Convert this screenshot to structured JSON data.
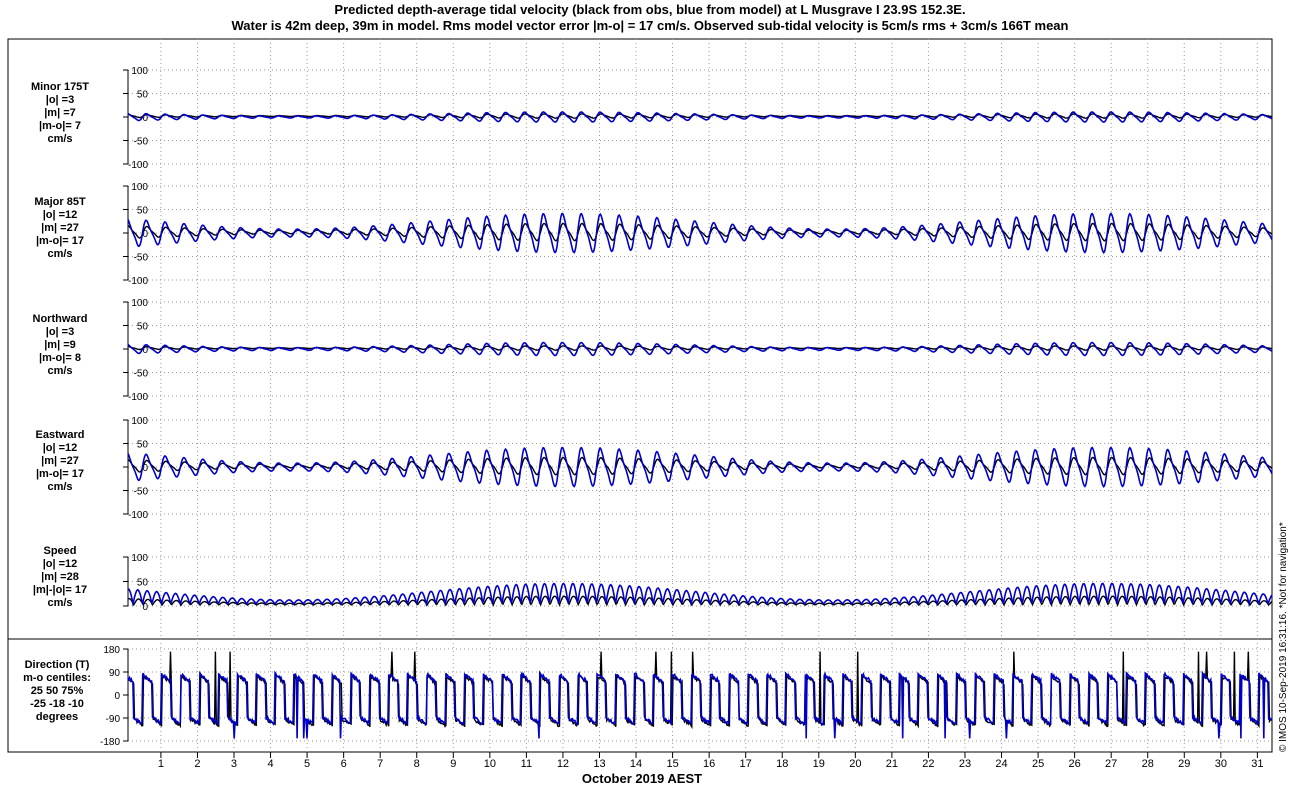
{
  "chart_data": {
    "type": "line",
    "title_lines": [
      "Predicted depth-average tidal velocity (black from obs, blue from model) at L Musgrave I 23.9S 152.3E.",
      "Water is 42m deep, 39m in model. Rms model vector error |m-o| = 17 cm/s. Observed sub-tidal velocity is 5cm/s rms + 3cm/s 166T mean"
    ],
    "xlabel": "October 2019 AEST",
    "x_ticks": [
      "1",
      "2",
      "3",
      "4",
      "5",
      "6",
      "7",
      "8",
      "9",
      "10",
      "11",
      "12",
      "13",
      "14",
      "15",
      "16",
      "17",
      "18",
      "19",
      "20",
      "21",
      "22",
      "23",
      "24",
      "25",
      "26",
      "27",
      "28",
      "29",
      "30",
      "31"
    ],
    "xlim": [
      0.1,
      31.4
    ],
    "grid": true,
    "series_colors": {
      "obs": "#000000",
      "model": "#0000c8"
    },
    "credit": "© IMOS 10-Sep-2019 16:31:16. *Not for navigation*",
    "panels": [
      {
        "id": "minor",
        "label_lines": [
          "Minor 175T",
          "|o| =3",
          "|m| =7",
          "|m-o|= 7",
          "cm/s"
        ],
        "ylim": [
          -100,
          100
        ],
        "yticks": [
          "100",
          "50",
          "0",
          "-50",
          "-100"
        ],
        "obs_amp": 3,
        "model_amp": 7
      },
      {
        "id": "major",
        "label_lines": [
          "Major 85T",
          "|o| =12",
          "|m| =27",
          "|m-o|= 17",
          "cm/s"
        ],
        "ylim": [
          -100,
          100
        ],
        "yticks": [
          "100",
          "50",
          "0",
          "-50",
          "-100"
        ],
        "obs_amp": 12,
        "model_amp": 27
      },
      {
        "id": "northward",
        "label_lines": [
          "Northward",
          "|o| =3",
          "|m| =9",
          "|m-o|= 8",
          "cm/s"
        ],
        "ylim": [
          -100,
          100
        ],
        "yticks": [
          "100",
          "50",
          "0",
          "-50",
          "-100"
        ],
        "obs_amp": 3,
        "model_amp": 9
      },
      {
        "id": "eastward",
        "label_lines": [
          "Eastward",
          "|o| =12",
          "|m| =27",
          "|m-o|= 17",
          "cm/s"
        ],
        "ylim": [
          -100,
          100
        ],
        "yticks": [
          "100",
          "50",
          "0",
          "-50",
          "-100"
        ],
        "obs_amp": 12,
        "model_amp": 27
      },
      {
        "id": "speed",
        "label_lines": [
          "Speed",
          "|o| =12",
          "|m| =28",
          "|m|-|o|= 17",
          "cm/s"
        ],
        "ylim": [
          0,
          100
        ],
        "yticks": [
          "100",
          "50",
          "0"
        ],
        "obs_amp": 12,
        "model_amp": 28
      },
      {
        "id": "direction",
        "label_lines": [
          "Direction (T)",
          "m-o centiles:",
          "25  50  75%",
          "-25 -18 -10",
          "degrees"
        ],
        "ylim": [
          -180,
          180
        ],
        "yticks": [
          "180",
          "90",
          "0",
          "-90",
          "-180"
        ]
      }
    ]
  }
}
